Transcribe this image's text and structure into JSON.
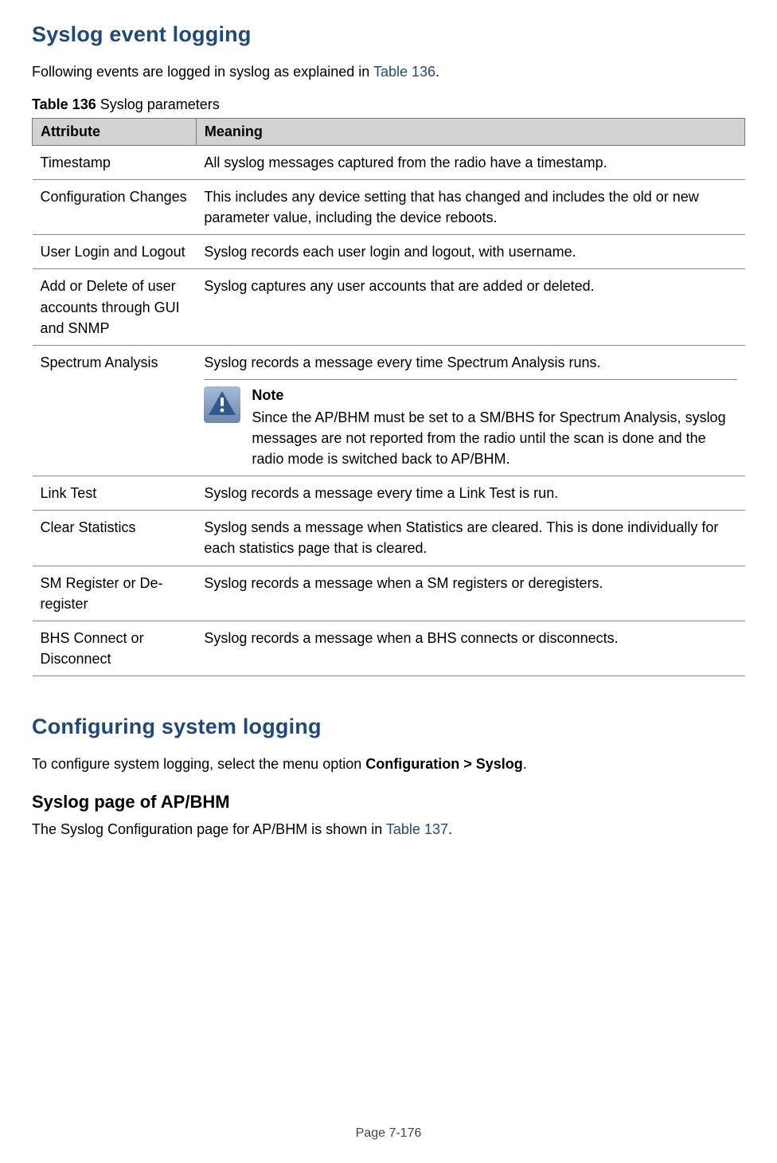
{
  "heading1": "Syslog event logging",
  "intro": {
    "pre": "Following events are logged in syslog as explained in ",
    "link": "Table 136",
    "post": "."
  },
  "tableCaption": {
    "label": "Table 136",
    "desc": " Syslog parameters"
  },
  "tableHeaders": {
    "attr": "Attribute",
    "mean": "Meaning"
  },
  "rows": [
    {
      "attr": "Timestamp",
      "mean": "All syslog messages captured from the radio have a timestamp."
    },
    {
      "attr": "Configuration Changes",
      "mean": "This includes any device setting that has changed and includes the old or new parameter value, including the device reboots."
    },
    {
      "attr": "User Login and Logout",
      "mean": "Syslog records each user login and logout, with username."
    },
    {
      "attr": "Add or Delete of user accounts through GUI and SNMP",
      "mean": "Syslog captures any user accounts that are added or deleted."
    },
    {
      "attr": "Spectrum Analysis",
      "mean": "Syslog records a message every time Spectrum Analysis runs.",
      "note": {
        "label": "Note",
        "text": "Since the AP/BHM must be set to a SM/BHS for Spectrum Analysis, syslog messages are not reported from the radio until the scan is done and the radio mode is switched back to AP/BHM."
      }
    },
    {
      "attr": "Link Test",
      "mean": "Syslog records a message every time a Link Test is run."
    },
    {
      "attr": "Clear Statistics",
      "mean": "Syslog sends a message when Statistics are cleared. This is done individually for each statistics page that is cleared."
    },
    {
      "attr": "SM Register or De-register",
      "mean": "Syslog records a message when a SM registers or deregisters."
    },
    {
      "attr": "BHS Connect or Disconnect",
      "mean": "Syslog records a message when a BHS connects or disconnects."
    }
  ],
  "heading2": "Configuring system logging",
  "config": {
    "pre": "To configure system logging, select the menu option ",
    "strong": "Configuration > Syslog",
    "post": "."
  },
  "heading3": "Syslog page of AP/BHM",
  "syslogPage": {
    "pre": "The Syslog Configuration page for AP/BHM is shown in ",
    "link": "Table 137",
    "post": "."
  },
  "footer": "Page 7-176"
}
